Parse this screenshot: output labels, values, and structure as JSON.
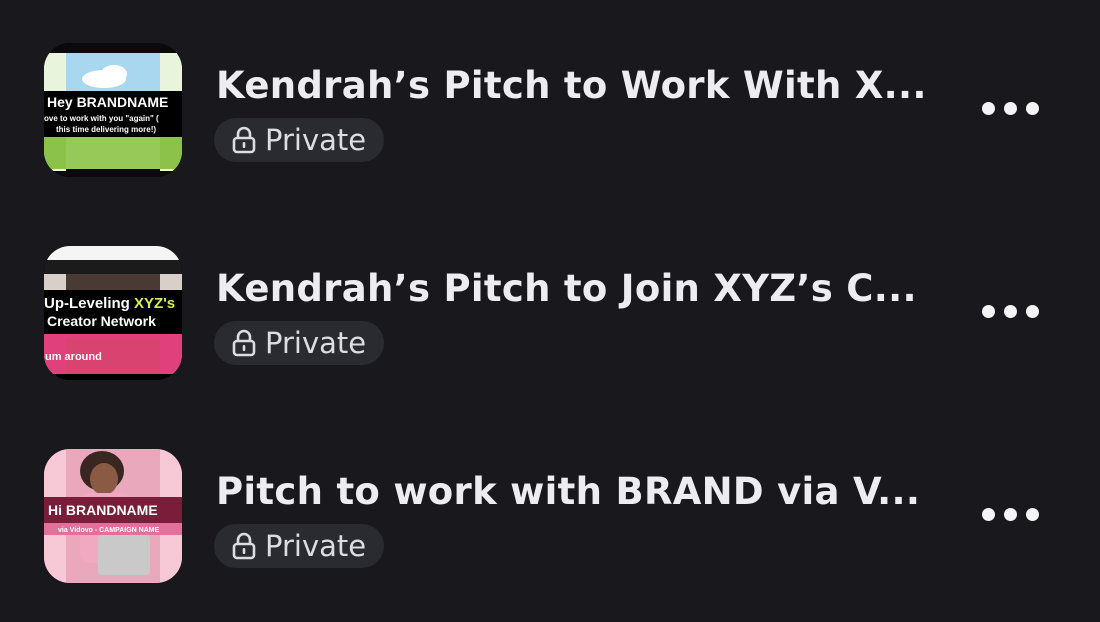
{
  "colors": {
    "background": "#18181d",
    "title_text": "#ececf1",
    "badge_bg": "#2a2b31",
    "badge_text": "#dcdce2",
    "more_icon": "#f4f4f6"
  },
  "items": [
    {
      "title": "Kendrah’s Pitch to Work With X...",
      "privacy_label": "Private",
      "privacy_icon": "lock-icon",
      "menu_icon": "more-horizontal-icon",
      "thumbnail": {
        "headline": "Hey BRANDNAME",
        "line1": "ove to work with you \"again\" (",
        "line2": "this time delivering more!)"
      }
    },
    {
      "title": "Kendrah’s Pitch to Join XYZ’s C...",
      "privacy_label": "Private",
      "privacy_icon": "lock-icon",
      "menu_icon": "more-horizontal-icon",
      "thumbnail": {
        "headline_a": "Up-Leveling ",
        "headline_b": "XYZ's",
        "line1": "Creator Network",
        "caption": "um around"
      }
    },
    {
      "title": "Pitch to work with BRAND via V...",
      "privacy_label": "Private",
      "privacy_icon": "lock-icon",
      "menu_icon": "more-horizontal-icon",
      "thumbnail": {
        "headline": "Hi BRANDNAME",
        "line1": "via Vidovo - CAMPAIGN NAME"
      }
    }
  ]
}
